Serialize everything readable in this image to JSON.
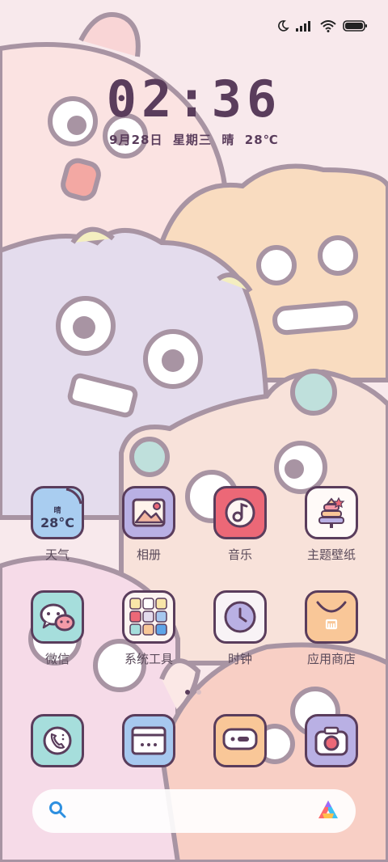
{
  "status_bar": {
    "icons": [
      "moon-icon",
      "signal-icon",
      "wifi-icon",
      "battery-icon"
    ]
  },
  "lock": {
    "time": "02:36",
    "date": "9月28日  星期三  晴  28℃"
  },
  "apps": [
    {
      "label": "天气",
      "icon": "weather-icon",
      "weather_small": "晴",
      "weather_temp": "28°C"
    },
    {
      "label": "相册",
      "icon": "gallery-icon"
    },
    {
      "label": "音乐",
      "icon": "music-icon"
    },
    {
      "label": "主题壁纸",
      "icon": "themes-icon"
    },
    {
      "label": "微信",
      "icon": "wechat-icon"
    },
    {
      "label": "系统工具",
      "icon": "system-tools-folder-icon"
    },
    {
      "label": "时钟",
      "icon": "clock-icon"
    },
    {
      "label": "应用商店",
      "icon": "app-store-icon"
    }
  ],
  "dock": [
    {
      "icon": "phone-icon"
    },
    {
      "icon": "browser-icon"
    },
    {
      "icon": "messages-icon"
    },
    {
      "icon": "camera-icon"
    }
  ],
  "page_indicator": {
    "count": 2,
    "active": 0
  },
  "search": {
    "icon": "search-icon",
    "assistant_icon": "assistant-icon"
  },
  "colors": {
    "text_dark": "#5a3d5c",
    "weather": "#a9cdf0",
    "gallery": "#b9b0e4",
    "music": "#ec6877",
    "themes": "#fffaf8",
    "wechat": "#a6dedc",
    "tools": "#fdf4f1",
    "clock": "#f8f3f6",
    "store": "#f9c798",
    "phone": "#a6dedc",
    "browser": "#a7c8ef",
    "messages": "#f9c798",
    "camera": "#b9b0e4"
  }
}
